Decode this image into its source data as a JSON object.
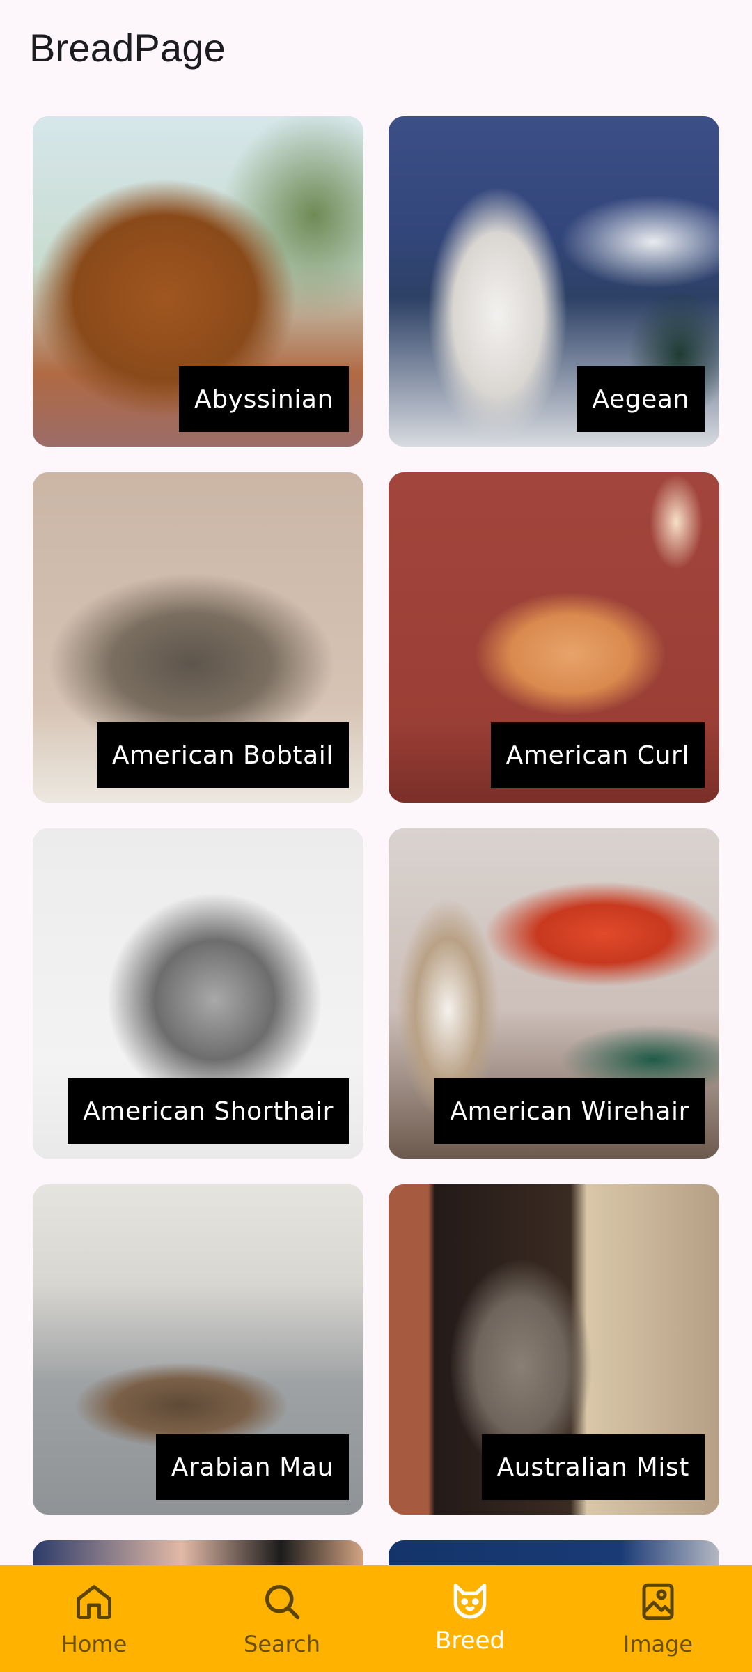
{
  "page": {
    "title": "BreadPage"
  },
  "breeds": [
    {
      "name": "Abyssinian"
    },
    {
      "name": "Aegean"
    },
    {
      "name": "American Bobtail"
    },
    {
      "name": "American Curl"
    },
    {
      "name": "American Shorthair"
    },
    {
      "name": "American Wirehair"
    },
    {
      "name": "Arabian Mau"
    },
    {
      "name": "Australian Mist"
    }
  ],
  "bottom_nav": {
    "items": [
      {
        "label": "Home",
        "icon": "home-icon"
      },
      {
        "label": "Search",
        "icon": "search-icon"
      },
      {
        "label": "Breed",
        "icon": "cat-icon",
        "active": true
      },
      {
        "label": "Image",
        "icon": "image-icon"
      }
    ],
    "background": "#ffb300",
    "active_color": "#ffffff"
  }
}
